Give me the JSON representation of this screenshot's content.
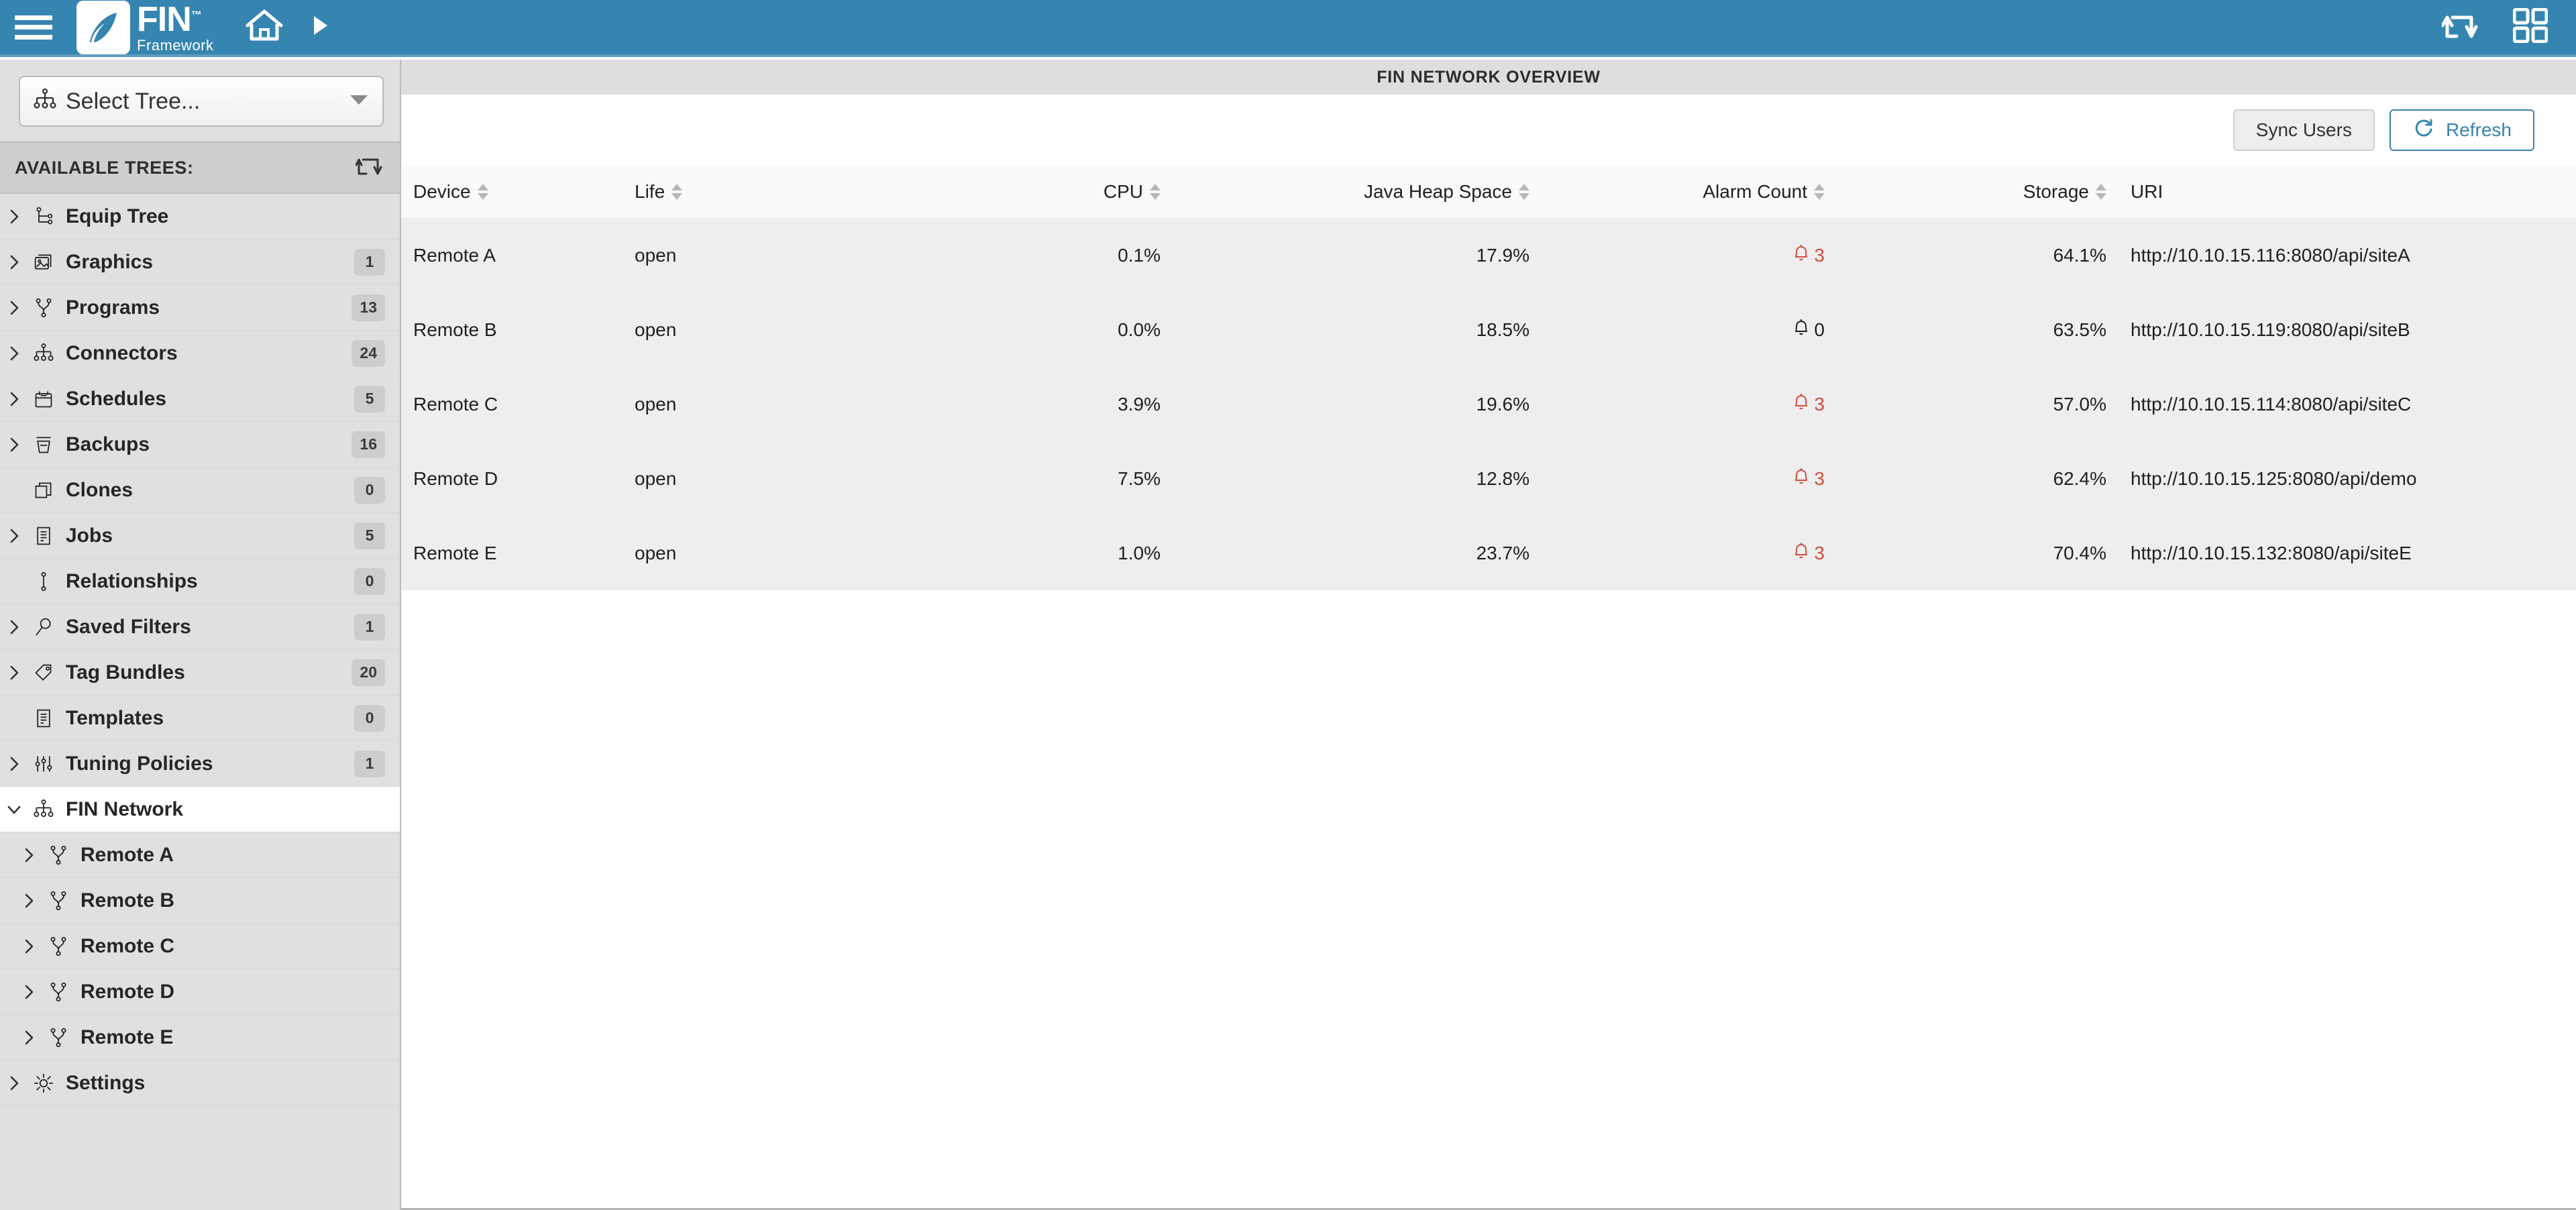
{
  "topbar": {
    "menu_icon": "hamburger-icon",
    "logo_name": "FIN",
    "logo_tagline": "Framework",
    "logo_tm": "™",
    "home_icon": "home-icon",
    "forward_icon": "play-arrow-icon",
    "sync_icon": "sync-arrows-icon",
    "apps_icon": "grid-apps-icon",
    "background_color": "#3585b0"
  },
  "sidebar": {
    "tree_select": {
      "label": "Select Tree...",
      "icon": "sitemap-icon",
      "caret_icon": "chevron-down-icon"
    },
    "available_header": {
      "label": "AVAILABLE TREES:",
      "refresh_icon": "sync-arrows-icon"
    },
    "items": [
      {
        "label": "Equip Tree",
        "badge": "",
        "icon": "branch-icon",
        "expandable": true,
        "selected": false,
        "indent": false
      },
      {
        "label": "Graphics",
        "badge": "1",
        "icon": "image-icon",
        "expandable": true,
        "selected": false,
        "indent": false
      },
      {
        "label": "Programs",
        "badge": "13",
        "icon": "fork-icon",
        "expandable": true,
        "selected": false,
        "indent": false
      },
      {
        "label": "Connectors",
        "badge": "24",
        "icon": "sitemap-icon",
        "expandable": true,
        "selected": false,
        "indent": false
      },
      {
        "label": "Schedules",
        "badge": "5",
        "icon": "calendar-icon",
        "expandable": true,
        "selected": false,
        "indent": false
      },
      {
        "label": "Backups",
        "badge": "16",
        "icon": "archive-icon",
        "expandable": true,
        "selected": false,
        "indent": false
      },
      {
        "label": "Clones",
        "badge": "0",
        "icon": "copy-icon",
        "expandable": false,
        "selected": false,
        "indent": false
      },
      {
        "label": "Jobs",
        "badge": "5",
        "icon": "document-icon",
        "expandable": true,
        "selected": false,
        "indent": false
      },
      {
        "label": "Relationships",
        "badge": "0",
        "icon": "link-node-icon",
        "expandable": false,
        "selected": false,
        "indent": false
      },
      {
        "label": "Saved Filters",
        "badge": "1",
        "icon": "search-icon",
        "expandable": true,
        "selected": false,
        "indent": false
      },
      {
        "label": "Tag Bundles",
        "badge": "20",
        "icon": "tag-icon",
        "expandable": true,
        "selected": false,
        "indent": false
      },
      {
        "label": "Templates",
        "badge": "0",
        "icon": "document-icon",
        "expandable": false,
        "selected": false,
        "indent": false
      },
      {
        "label": "Tuning Policies",
        "badge": "1",
        "icon": "sliders-icon",
        "expandable": true,
        "selected": false,
        "indent": false
      },
      {
        "label": "FIN Network",
        "badge": "",
        "icon": "sitemap-icon",
        "expandable": true,
        "selected": true,
        "expanded": true,
        "indent": false
      },
      {
        "label": "Remote A",
        "badge": "",
        "icon": "fork-icon",
        "expandable": true,
        "selected": false,
        "indent": true
      },
      {
        "label": "Remote B",
        "badge": "",
        "icon": "fork-icon",
        "expandable": true,
        "selected": false,
        "indent": true
      },
      {
        "label": "Remote C",
        "badge": "",
        "icon": "fork-icon",
        "expandable": true,
        "selected": false,
        "indent": true
      },
      {
        "label": "Remote D",
        "badge": "",
        "icon": "fork-icon",
        "expandable": true,
        "selected": false,
        "indent": true
      },
      {
        "label": "Remote E",
        "badge": "",
        "icon": "fork-icon",
        "expandable": true,
        "selected": false,
        "indent": true
      },
      {
        "label": "Settings",
        "badge": "",
        "icon": "gear-icon",
        "expandable": true,
        "selected": false,
        "indent": false
      }
    ]
  },
  "main": {
    "panel_title": "FIN NETWORK OVERVIEW",
    "toolbar": {
      "sync_users_label": "Sync Users",
      "refresh_label": "Refresh",
      "refresh_icon": "refresh-circle-icon",
      "accent_color": "#3585b0"
    },
    "table": {
      "columns": [
        {
          "label": "Device",
          "sortable": true,
          "align": "left"
        },
        {
          "label": "Life",
          "sortable": true,
          "align": "left"
        },
        {
          "label": "CPU",
          "sortable": true,
          "align": "right"
        },
        {
          "label": "Java Heap Space",
          "sortable": true,
          "align": "right"
        },
        {
          "label": "Alarm Count",
          "sortable": true,
          "align": "right"
        },
        {
          "label": "Storage",
          "sortable": true,
          "align": "right"
        },
        {
          "label": "URI",
          "sortable": false,
          "align": "left"
        }
      ],
      "rows": [
        {
          "device": "Remote A",
          "life": "open",
          "cpu": "0.1%",
          "heap": "17.9%",
          "alarm": "3",
          "alarm_state": "active",
          "storage": "64.1%",
          "uri": "http://10.10.15.116:8080/api/siteA"
        },
        {
          "device": "Remote B",
          "life": "open",
          "cpu": "0.0%",
          "heap": "18.5%",
          "alarm": "0",
          "alarm_state": "zero",
          "storage": "63.5%",
          "uri": "http://10.10.15.119:8080/api/siteB"
        },
        {
          "device": "Remote C",
          "life": "open",
          "cpu": "3.9%",
          "heap": "19.6%",
          "alarm": "3",
          "alarm_state": "active",
          "storage": "57.0%",
          "uri": "http://10.10.15.114:8080/api/siteC"
        },
        {
          "device": "Remote D",
          "life": "open",
          "cpu": "7.5%",
          "heap": "12.8%",
          "alarm": "3",
          "alarm_state": "active",
          "storage": "62.4%",
          "uri": "http://10.10.15.125:8080/api/demo"
        },
        {
          "device": "Remote E",
          "life": "open",
          "cpu": "1.0%",
          "heap": "23.7%",
          "alarm": "3",
          "alarm_state": "active",
          "storage": "70.4%",
          "uri": "http://10.10.15.132:8080/api/siteE"
        }
      ],
      "colors": {
        "life_open": "#4cae7e",
        "alarm_active": "#cf4c41",
        "alarm_zero": "#1f1f1f",
        "row_bg": "#eeeeee",
        "header_bg": "#fafafa"
      }
    }
  }
}
